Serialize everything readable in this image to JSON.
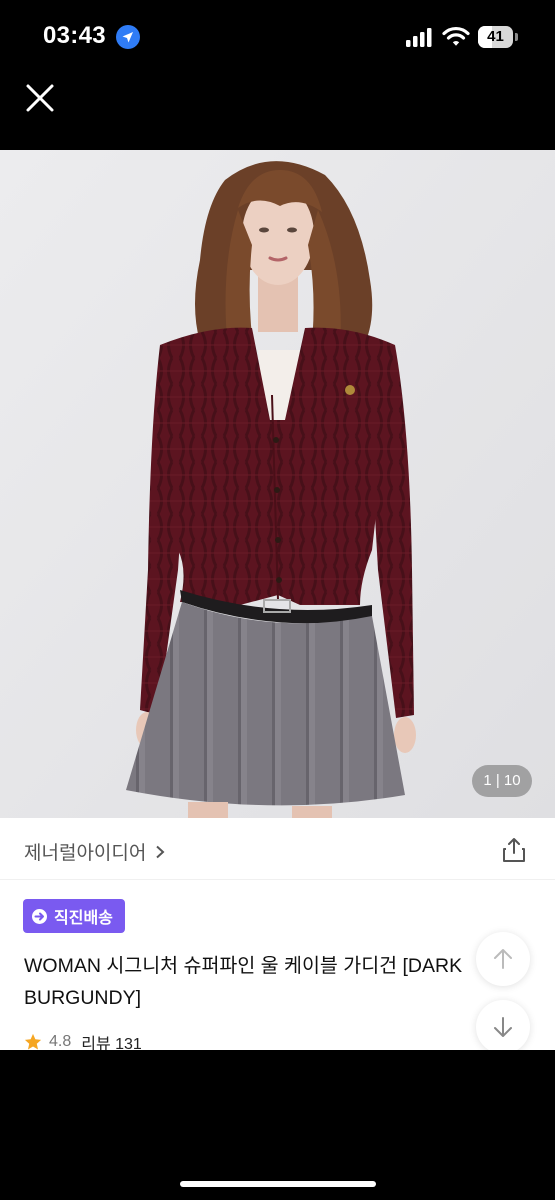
{
  "status_bar": {
    "time": "03:43",
    "battery": "41",
    "battery_level": 0.41,
    "icons": [
      "location-arrow-icon",
      "cellular-signal-icon",
      "wifi-icon",
      "battery-icon"
    ]
  },
  "product": {
    "image_counter": "1 | 10",
    "brand": "제너럴아이디어",
    "badge": "직진배송",
    "title": "WOMAN 시그니처 슈퍼파인 울 케이블 가디건 [DARK BURGUNDY]",
    "rating": "4.8",
    "reviews": "리뷰 131"
  },
  "colors": {
    "badge": "#7a5af0",
    "star": "#f5a623",
    "cardigan": "#5c1420",
    "skirt": "#7b7880"
  }
}
